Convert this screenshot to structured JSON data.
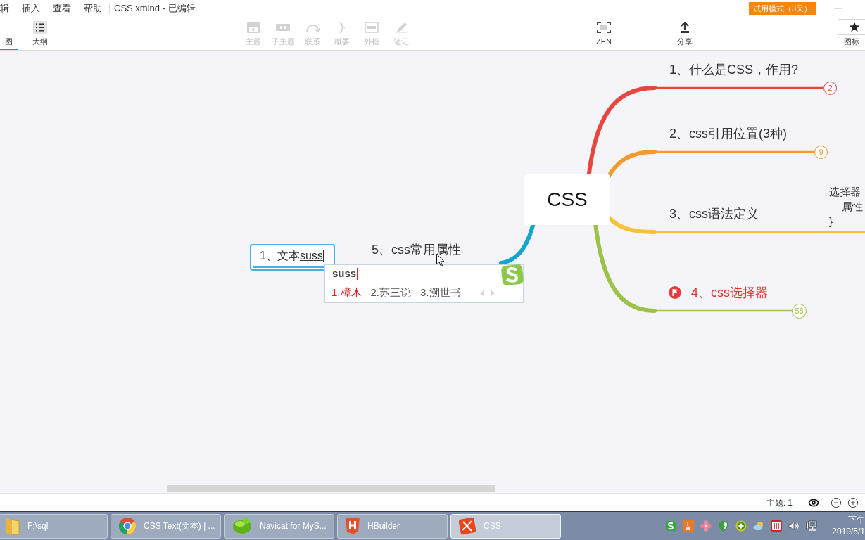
{
  "menu_bar": {
    "items": [
      {
        "label": "辑"
      },
      {
        "label": "插入"
      },
      {
        "label": "查看"
      },
      {
        "label": "帮助"
      }
    ],
    "document_title": "CSS.xmind - 已编辑",
    "trial_badge": "试用模式（3天）"
  },
  "toolbar": {
    "view_tabs": [
      {
        "label": "图",
        "kind": "map",
        "selected": true
      },
      {
        "label": "大纲",
        "kind": "outline",
        "selected": false
      }
    ],
    "tools": [
      {
        "label": "主题",
        "kind": "topic",
        "disabled": true
      },
      {
        "label": "子主题",
        "kind": "subtopic",
        "disabled": true
      },
      {
        "label": "联系",
        "kind": "relationship",
        "disabled": true
      },
      {
        "label": "概要",
        "kind": "summary",
        "disabled": true
      },
      {
        "label": "外框",
        "kind": "boundary",
        "disabled": true
      },
      {
        "label": "笔记",
        "kind": "note",
        "disabled": true
      }
    ],
    "view_tools": [
      {
        "label": "ZEN",
        "kind": "zen"
      },
      {
        "label": "分享",
        "kind": "share"
      }
    ],
    "panel_button": {
      "label": "图标"
    }
  },
  "canvas": {
    "central_topic": "CSS",
    "branches": [
      {
        "label": "1、什么是CSS，作用?",
        "color": "#e8453c",
        "count": "2",
        "flagged": false
      },
      {
        "label": "2、css引用位置(3种)",
        "color": "#f39a2e",
        "count": "9",
        "flagged": false
      },
      {
        "label": "3、css语法定义",
        "color": "#f7c23a",
        "flagged": false
      },
      {
        "label": "4、css选择器",
        "color": "#9cc24a",
        "count": "58",
        "flagged": true
      }
    ],
    "partial_topic": {
      "lines": [
        {
          "text": "选择器",
          "indent": false
        },
        {
          "text": "属性",
          "indent": true
        },
        {
          "text": "}",
          "indent": false
        }
      ]
    },
    "left_branch": {
      "label": "5、css常用属性",
      "color": "#13a4d0",
      "child": {
        "text": "1、文本",
        "composition": "suss",
        "selected": true
      }
    }
  },
  "ime": {
    "composition": "suss",
    "candidates": [
      {
        "label": "1.樟木",
        "selected": true
      },
      {
        "label": "2.苏三说",
        "selected": false
      },
      {
        "label": "3.溯世书",
        "selected": false
      }
    ]
  },
  "status_bar": {
    "topic_count": "主题: 1"
  },
  "taskbar": {
    "items": [
      {
        "label": "F:\\sql",
        "kind": "folder",
        "selected": false
      },
      {
        "label": "CSS Text(文本) | ...",
        "kind": "browser",
        "selected": false
      },
      {
        "label": "Navicat for MyS...",
        "kind": "database",
        "selected": false
      },
      {
        "label": "HBuilder",
        "kind": "editor",
        "selected": false
      },
      {
        "label": "CSS",
        "kind": "mindmap",
        "selected": true
      }
    ],
    "clock": {
      "period": "下午",
      "date": "2019/5/1"
    }
  }
}
